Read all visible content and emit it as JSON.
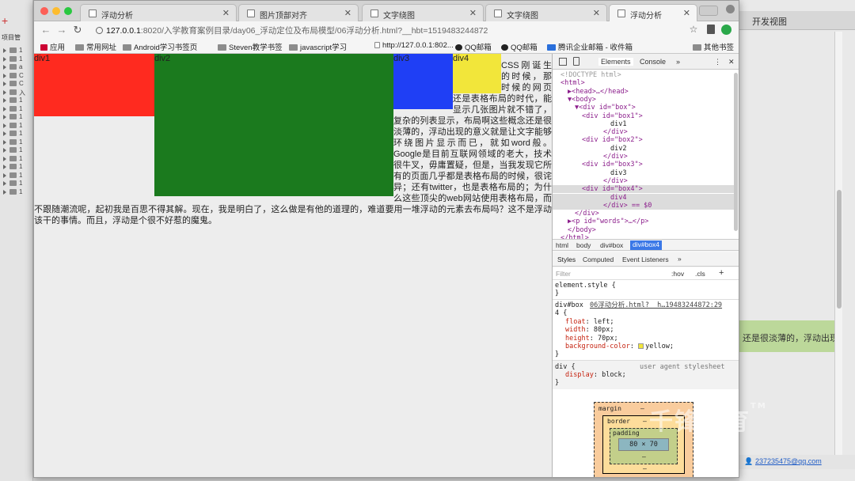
{
  "ide": {
    "project_label": "项目管",
    "devview_label": "开发视图",
    "highlight_text": "还是很淡薄的，浮动出现",
    "user_email": "237235475@qq.com",
    "tree_rows": [
      "1",
      "1",
      "a",
      "C",
      "C",
      "入",
      "1",
      "1",
      "1",
      "1",
      "1",
      "1",
      "1",
      "1",
      "1",
      "1",
      "1",
      "1"
    ]
  },
  "browser": {
    "tabs": [
      {
        "label": "浮动分析",
        "active": false
      },
      {
        "label": "图片顶部对齐",
        "active": false
      },
      {
        "label": "文字绕图",
        "active": false
      },
      {
        "label": "文字绕图",
        "active": false
      },
      {
        "label": "浮动分析",
        "active": true
      }
    ],
    "url_host": "127.0.0.1",
    "url_rest": ":8020/入学教育案例目录/day06_浮动定位及布局模型/06浮动分析.html?__hbt=1519483244872",
    "bookmarks": [
      "应用",
      "常用网址",
      "Android学习书签页",
      "Steven教学书签",
      "javascript学习",
      "http://127.0.0.1:802...",
      "QQ邮箱",
      "QQ邮箱",
      "腾讯企业邮箱 - 收件箱",
      "其他书签"
    ]
  },
  "page": {
    "div1": "div1",
    "div2": "div2",
    "div3": "div3",
    "div4": "div4",
    "words": "CSS刚诞生的时候，那时候的网页还是表格布局的时代，能显示几张图片就不错了，复杂的列表显示，布局啊这些概念还是很淡薄的，浮动出现的意义就是让文字能够环绕图片显示而已，就如word般。Google是目前互联网领域的老大，技术很牛叉，毋庸置疑，但是，当我发现它所有的页面几乎都是表格布局的时候，很诧异；还有twitter，也是表格布局的；为什么这些顶尖的web网站使用表格布局，而不跟随潮流呢，起初我是百思不得其解。现在，我是明白了，这么做是有他的道理的，难道要用一堆浮动的元素去布局吗？这不是浮动该干的事情。而且，浮动是个很不好惹的魔鬼。"
  },
  "devtools": {
    "tabs": [
      "Elements",
      "Console"
    ],
    "dom_lines": [
      {
        "indent": 0,
        "kind": "comment",
        "text": "<!DOCTYPE html>"
      },
      {
        "indent": 0,
        "kind": "tag",
        "text": "<html>"
      },
      {
        "indent": 1,
        "kind": "tag",
        "text": "▶<head>…</head>"
      },
      {
        "indent": 1,
        "kind": "tag",
        "text": "▼<body>"
      },
      {
        "indent": 2,
        "kind": "tag",
        "text": "▼<div id=\"box\">"
      },
      {
        "indent": 3,
        "kind": "tag",
        "text": "<div id=\"box1\">"
      },
      {
        "indent": 7,
        "kind": "text",
        "text": "div1"
      },
      {
        "indent": 6,
        "kind": "tag",
        "text": "</div>"
      },
      {
        "indent": 3,
        "kind": "tag",
        "text": "<div id=\"box2\">"
      },
      {
        "indent": 7,
        "kind": "text",
        "text": "div2"
      },
      {
        "indent": 6,
        "kind": "tag",
        "text": "</div>"
      },
      {
        "indent": 3,
        "kind": "tag",
        "text": "<div id=\"box3\">"
      },
      {
        "indent": 7,
        "kind": "text",
        "text": "div3"
      },
      {
        "indent": 6,
        "kind": "tag",
        "text": "</div>"
      },
      {
        "indent": 3,
        "kind": "sel",
        "text": "<div id=\"box4\">"
      },
      {
        "indent": 7,
        "kind": "sel",
        "text": "div4"
      },
      {
        "indent": 6,
        "kind": "sel",
        "text": "</div> == $0"
      },
      {
        "indent": 2,
        "kind": "tag",
        "text": "</div>"
      },
      {
        "indent": 1,
        "kind": "tag",
        "text": "▶<p id=\"words\">…</p>"
      },
      {
        "indent": 1,
        "kind": "tag",
        "text": "</body>"
      },
      {
        "indent": 0,
        "kind": "tag",
        "text": "</html>"
      }
    ],
    "breadcrumbs": [
      "html",
      "body",
      "div#box",
      "div#box4"
    ],
    "style_tabs": [
      "Styles",
      "Computed",
      "Event Listeners"
    ],
    "filter_placeholder": "Filter",
    "filter_hov": ":hov",
    "filter_cls": ".cls",
    "rule_element_style": "element.style {",
    "rule_close": "}",
    "rule_box_selector": "div#box",
    "rule_box_source": "06浮动分析.html?__h…19483244872:29",
    "rule_box_source2": "4 {",
    "props": [
      {
        "name": "float",
        "value": "left;"
      },
      {
        "name": "width",
        "value": "80px;"
      },
      {
        "name": "height",
        "value": "70px;"
      },
      {
        "name": "background-color",
        "value": "yellow;"
      }
    ],
    "rule_div_selector": "div {",
    "rule_div_source": "user agent stylesheet",
    "rule_div_prop": "display",
    "rule_div_value": "block;",
    "boxmodel": {
      "margin": "margin",
      "border": "border",
      "padding": "padding",
      "content": "80 × 70",
      "dash": "–"
    }
  },
  "watermark": "千锋教育",
  "colors": {
    "div1": "#ff2a1f",
    "div2": "#1b7a1e",
    "div3": "#1f3ff5",
    "div4": "#f2e63a",
    "selected_row": "#dcdcdc",
    "crumb_active": "#3b78e7"
  }
}
